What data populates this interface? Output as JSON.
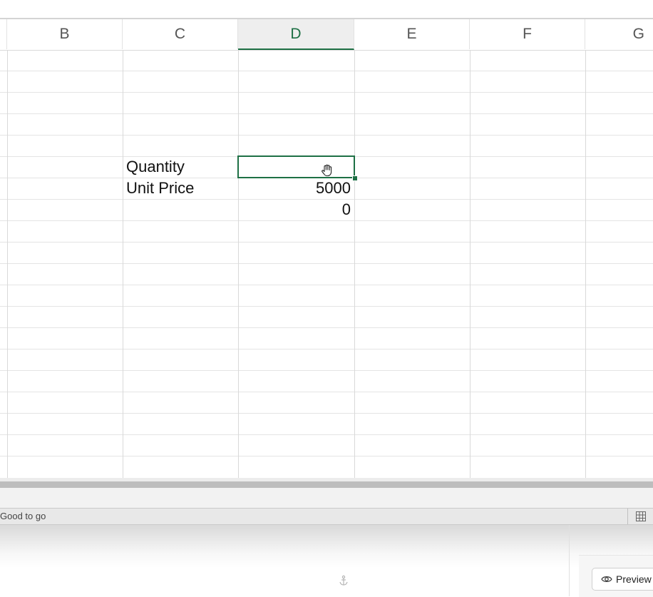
{
  "columns": [
    {
      "label": "B",
      "active": false
    },
    {
      "label": "C",
      "active": false
    },
    {
      "label": "D",
      "active": true
    },
    {
      "label": "E",
      "active": false
    },
    {
      "label": "F",
      "active": false
    },
    {
      "label": "G",
      "active": false
    }
  ],
  "cells": {
    "c5": "Quantity",
    "c6": "Unit Price",
    "d5": "",
    "d6": "5000",
    "d7": "0"
  },
  "selected_cell": "D5",
  "status": {
    "text": "Good to go"
  },
  "preview": {
    "label": "Preview"
  },
  "icons": {
    "cursor": "hand-cursor-icon",
    "view": "grid-view-icon",
    "anchor": "anchor-icon",
    "preview": "eye-icon"
  },
  "colors": {
    "accent": "#1e7045",
    "gridline": "#e4e4e4",
    "header_active_bg": "#eeeeee"
  }
}
